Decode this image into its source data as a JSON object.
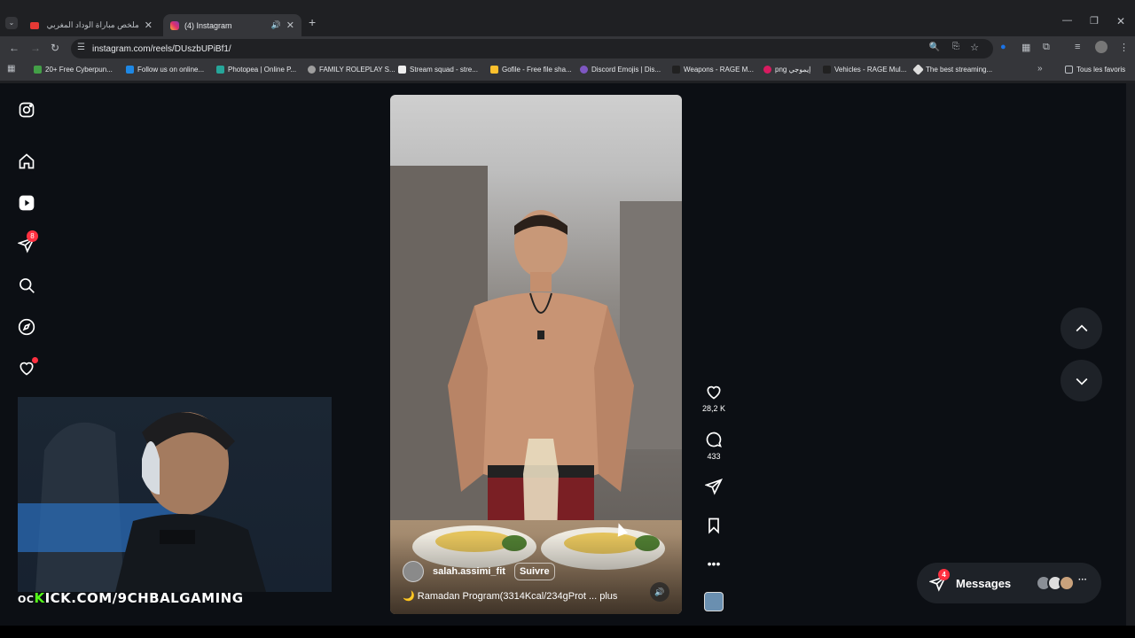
{
  "browser": {
    "tabs": [
      {
        "title": "ملخص مباراة الوداد المغربي وعزا",
        "active": false
      },
      {
        "title": "(4) Instagram",
        "active": true
      }
    ],
    "url": "instagram.com/reels/DUszbUPiBf1/",
    "bookmarks": [
      "20+ Free Cyberpun...",
      "Follow us on online...",
      "Photopea | Online P...",
      "FAMILY ROLEPLAY S...",
      "Stream squad - stre...",
      "Gofile - Free file sha...",
      "Discord Emojis | Dis...",
      "Weapons - RAGE M...",
      "png إيموجي",
      "Vehicles - RAGE Mul...",
      "The best streaming..."
    ],
    "all_bookmarks_label": "Tous les favoris"
  },
  "sidebar": {
    "notification_count": "8"
  },
  "reel": {
    "username": "salah.assimi_fit",
    "follow_label": "Suivre",
    "caption": "🌙 Ramadan Program(3314Kcal/234gProt ... plus",
    "likes": "28,2 K",
    "comments": "433"
  },
  "messages": {
    "label": "Messages",
    "count": "4"
  },
  "overlay": {
    "kick_prefix": "K",
    "kick_text": "ICK.COM/9CHBALGAMING",
    "oc": "OC"
  }
}
